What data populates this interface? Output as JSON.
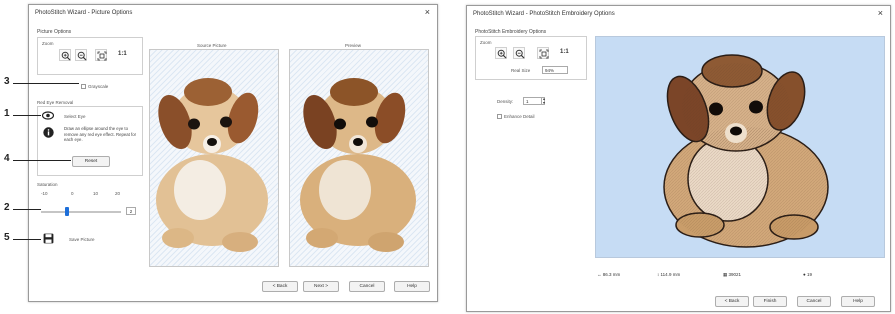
{
  "left_window": {
    "title": "PhotoStitch Wizard - Picture Options",
    "close_glyph": "×",
    "picture_options_label": "Picture Options",
    "zoom_label": "Zoom",
    "zoom_real_size_label": "1:1",
    "source_picture_label": "Source Picture",
    "preview_label": "Preview",
    "grayscale_label": "Grayscale",
    "red_eye_group_label": "Red Eye Removal",
    "select_eye_label": "Select Eye",
    "red_eye_help_text": "Draw an ellipse around the eye to remove any red eye effect. Repeat for each eye.",
    "reset_label": "Reset",
    "saturation_label": "Saturation",
    "saturation_ticks": [
      "-10",
      "0",
      "10",
      "20"
    ],
    "saturation_value": "2",
    "saturation_level_fraction": 0.33,
    "save_picture_label": "Save Picture",
    "buttons": {
      "back": "< Back",
      "next": "Next >",
      "cancel": "Cancel",
      "help": "Help"
    }
  },
  "callouts": [
    "3",
    "1",
    "4",
    "2",
    "5"
  ],
  "right_window": {
    "title": "PhotoStitch Wizard - PhotoStitch Embroidery Options",
    "options_label": "PhotoStitch Embroidery Options",
    "zoom_label": "Zoom",
    "zoom_real_size_label": "1:1",
    "real_size_label": "Real Size",
    "real_size_value": "94%",
    "density_label": "Density:",
    "density_value": "1",
    "enhance_detail_label": "Enhance Detail",
    "status": {
      "width": "86.3 mm",
      "height": "114.9 mm",
      "stitches": "39021",
      "colors": "19"
    },
    "buttons": {
      "back": "< Back",
      "finish": "Finish",
      "cancel": "Cancel",
      "help": "Help"
    }
  },
  "colors": {
    "accent": "#1e6fd9",
    "canvas_blue": "#c6dcf4",
    "dog_fur": "#d9b07c",
    "dog_ears": "#8a4f2a"
  }
}
